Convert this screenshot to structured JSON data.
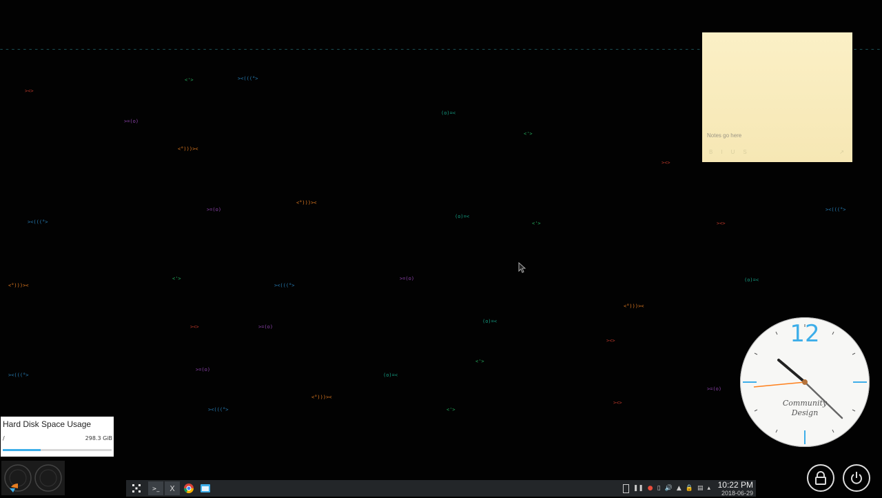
{
  "waves": {
    "line1": "~ ~ ~ ~ ~ ~ ~ ~ ~ ~ ~ ~ ~ ~ ~ ~ ~ ~ ~ ~ ~ ~ ~ ~ ~ ~ ~ ~ ~ ~ ~ ~ ~ ~ ~ ~ ~ ~ ~ ~ ~ ~ ~ ~ ~ ~ ~ ~ ~ ~ ~ ~ ~ ~ ~ ~ ~ ~ ~ ~ ~ ~ ~ ~ ~ ~ ~ ~ ~ ~ ~ ~ ~ ~ ~ ~ ~ ~ ~ ~ ~ ~ ~ ~ ~ ~ ~ ~ ~ ~ ~ ~ ~ ~ ~ ~ ~ ~ ~ ~ ~ ~ ~ ~ ~ ~ ~ ~ ~ ~ ~ ~ ~ ~ ~ ~ ~ ~ ~ ~ ~ ~ ~ ~ ~ ~ ~ ~ ~ ~ ~ ~ ~ ~ ~ ~ ~ ~ ~ ~ ~ ~ ~ ~ ~ ~ ~ ~ ~ ~ ~ ~ ~ ~ ~ ~ ~ ~ ~ ~",
    "line2": "^^^^   ^^^^  ^^^  ^^^   ^^^^  ^^^^  ^^^^^   ^^^  ^^^^  ^^^   ^^^^   ^^^  ^^^^  ^^^   ^^^^  ^^^^  ^^^^^   ^^^  ^^^^  ^^^   ^^^^   ^^^  ^^^^  ^^^   ^^^^  ^^^^  ^^^^^   ^^^  ^^^^  ^^^   ^^^^   ^^^  ^^^^  ^^^   ^^^^  ^^^^  ^^^^^   ^^^  ^^^^  ^^^   ^^^^   ^^^  ^^^^",
    "line3": "  ^^^^   ^^^   ^^^^  ^^^   ^^^^^  ^^^^   ^^^   ^^^^   ^^^  ^^^^^   ^^^   ^^^^  ^^^   ^^^^^  ^^^^   ^^^   ^^^^   ^^^  ^^^^^   ^^^   ^^^^  ^^^   ^^^^^  ^^^^   ^^^   ^^^^   ^^^  ^^^^^   ^^^   ^^^^  ^^^   ^^^^^  ^^^^   ^^^   ^^^^   ^^^  ^^^^^   ^^^   ^^^^  ^^^   ^^^^",
    "line4": "^^^^  ^^^   ^^^^^^  ^^   ^^^^   ^^^^  ^^^  ^^^^  ^^^   ^^^^^^  ^^   ^^^^   ^^^^  ^^^  ^^^^  ^^^   ^^^^^^  ^^   ^^^^   ^^^^  ^^^  ^^^^  ^^^   ^^^^^^  ^^   ^^^^   ^^^^  ^^^  ^^^^  ^^^   ^^^^^^  ^^   ^^^^   ^^^^  ^^^  ^^^^  ^^^   ^^^^^^  ^^   ^^^^   ^^^^"
  },
  "fish": [
    {
      "text": "><>",
      "color": "#c0392b"
    },
    {
      "text": "<'>",
      "color": "#27ae60"
    },
    {
      "text": "><(((°>",
      "color": "#2980b9"
    },
    {
      "text": "<°)))><",
      "color": "#e67e22"
    },
    {
      "text": ">=(o)",
      "color": "#8e44ad"
    },
    {
      "text": "(o)=<",
      "color": "#16a085"
    }
  ],
  "note": {
    "placeholder": "Notes go here",
    "fmt": [
      "B",
      "I",
      "U",
      "S"
    ],
    "corner": "↗"
  },
  "clock": {
    "twelve": "12",
    "brand_line1": "Community",
    "brand_line2": "Design"
  },
  "disk": {
    "title": "Hard Disk Space Usage",
    "mount": "/",
    "size": "298.3 GiB",
    "used_fraction": 0.35
  },
  "taskbar": {
    "launcher_icon": "kde-launcher-icon",
    "apps": [
      {
        "name": "terminal",
        "glyph": ">_"
      },
      {
        "name": "xterm",
        "glyph": "X"
      },
      {
        "name": "chrome",
        "glyph": "●"
      },
      {
        "name": "dolphin",
        "glyph": "▣"
      }
    ],
    "time": "10:22 PM",
    "date": "2018-06-29"
  },
  "colors": {
    "accent": "#3daee9",
    "panel": "#232629",
    "note": "#fbf0c6",
    "second_hand": "#ff7f1a"
  }
}
